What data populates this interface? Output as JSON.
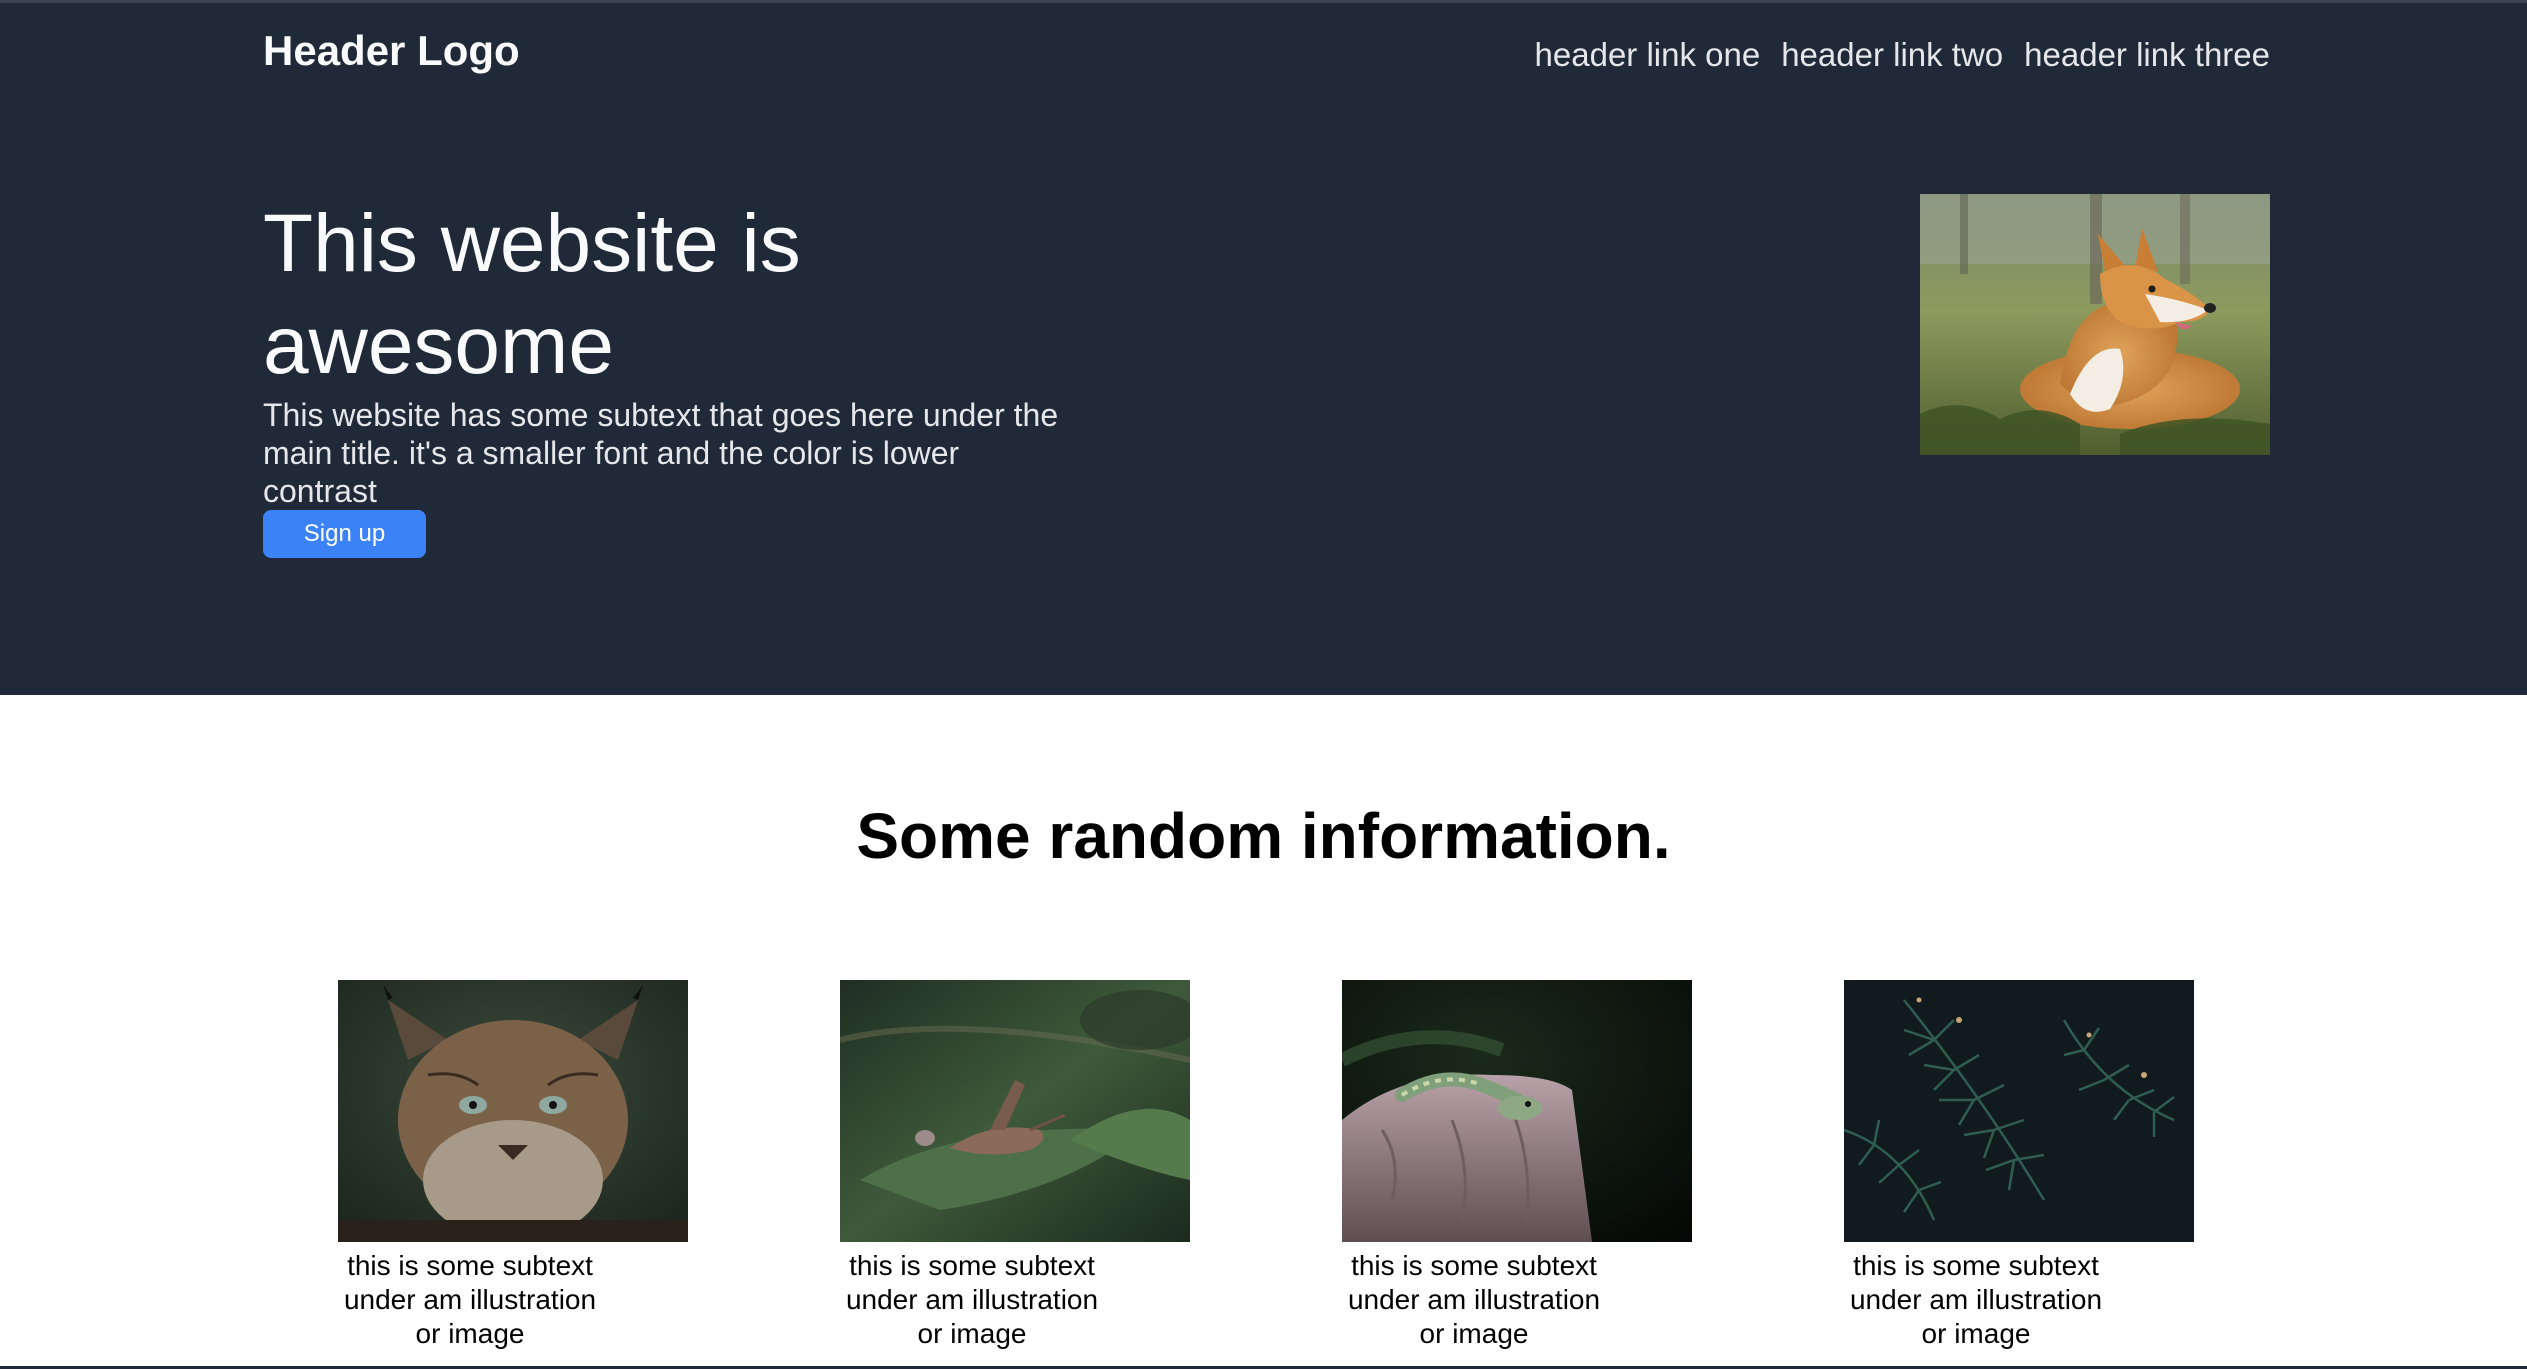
{
  "header": {
    "logo": "Header Logo",
    "links": [
      "header link one",
      "header link two",
      "header link three"
    ]
  },
  "hero": {
    "title": "This website is awesome",
    "subtitle": "This website has some subtext that goes here under the main title. it's a smaller font and the color is lower contrast",
    "button_label": "Sign up",
    "image_icon": "corgi-photo"
  },
  "info": {
    "title": "Some random information.",
    "cards": [
      {
        "image_icon": "lynx-photo",
        "text": "this is some subtext under am illustration or image"
      },
      {
        "image_icon": "grasshopper-photo",
        "text": "this is some subtext under am illustration or image"
      },
      {
        "image_icon": "snake-photo",
        "text": "this is some subtext under am illustration or image"
      },
      {
        "image_icon": "pine-branch-photo",
        "text": "this is some subtext under am illustration or image"
      }
    ]
  },
  "colors": {
    "hero_bg": "#1f2937",
    "button": "#3b82f6",
    "text_light": "#f9fafb",
    "subtext": "#e5e7eb"
  }
}
